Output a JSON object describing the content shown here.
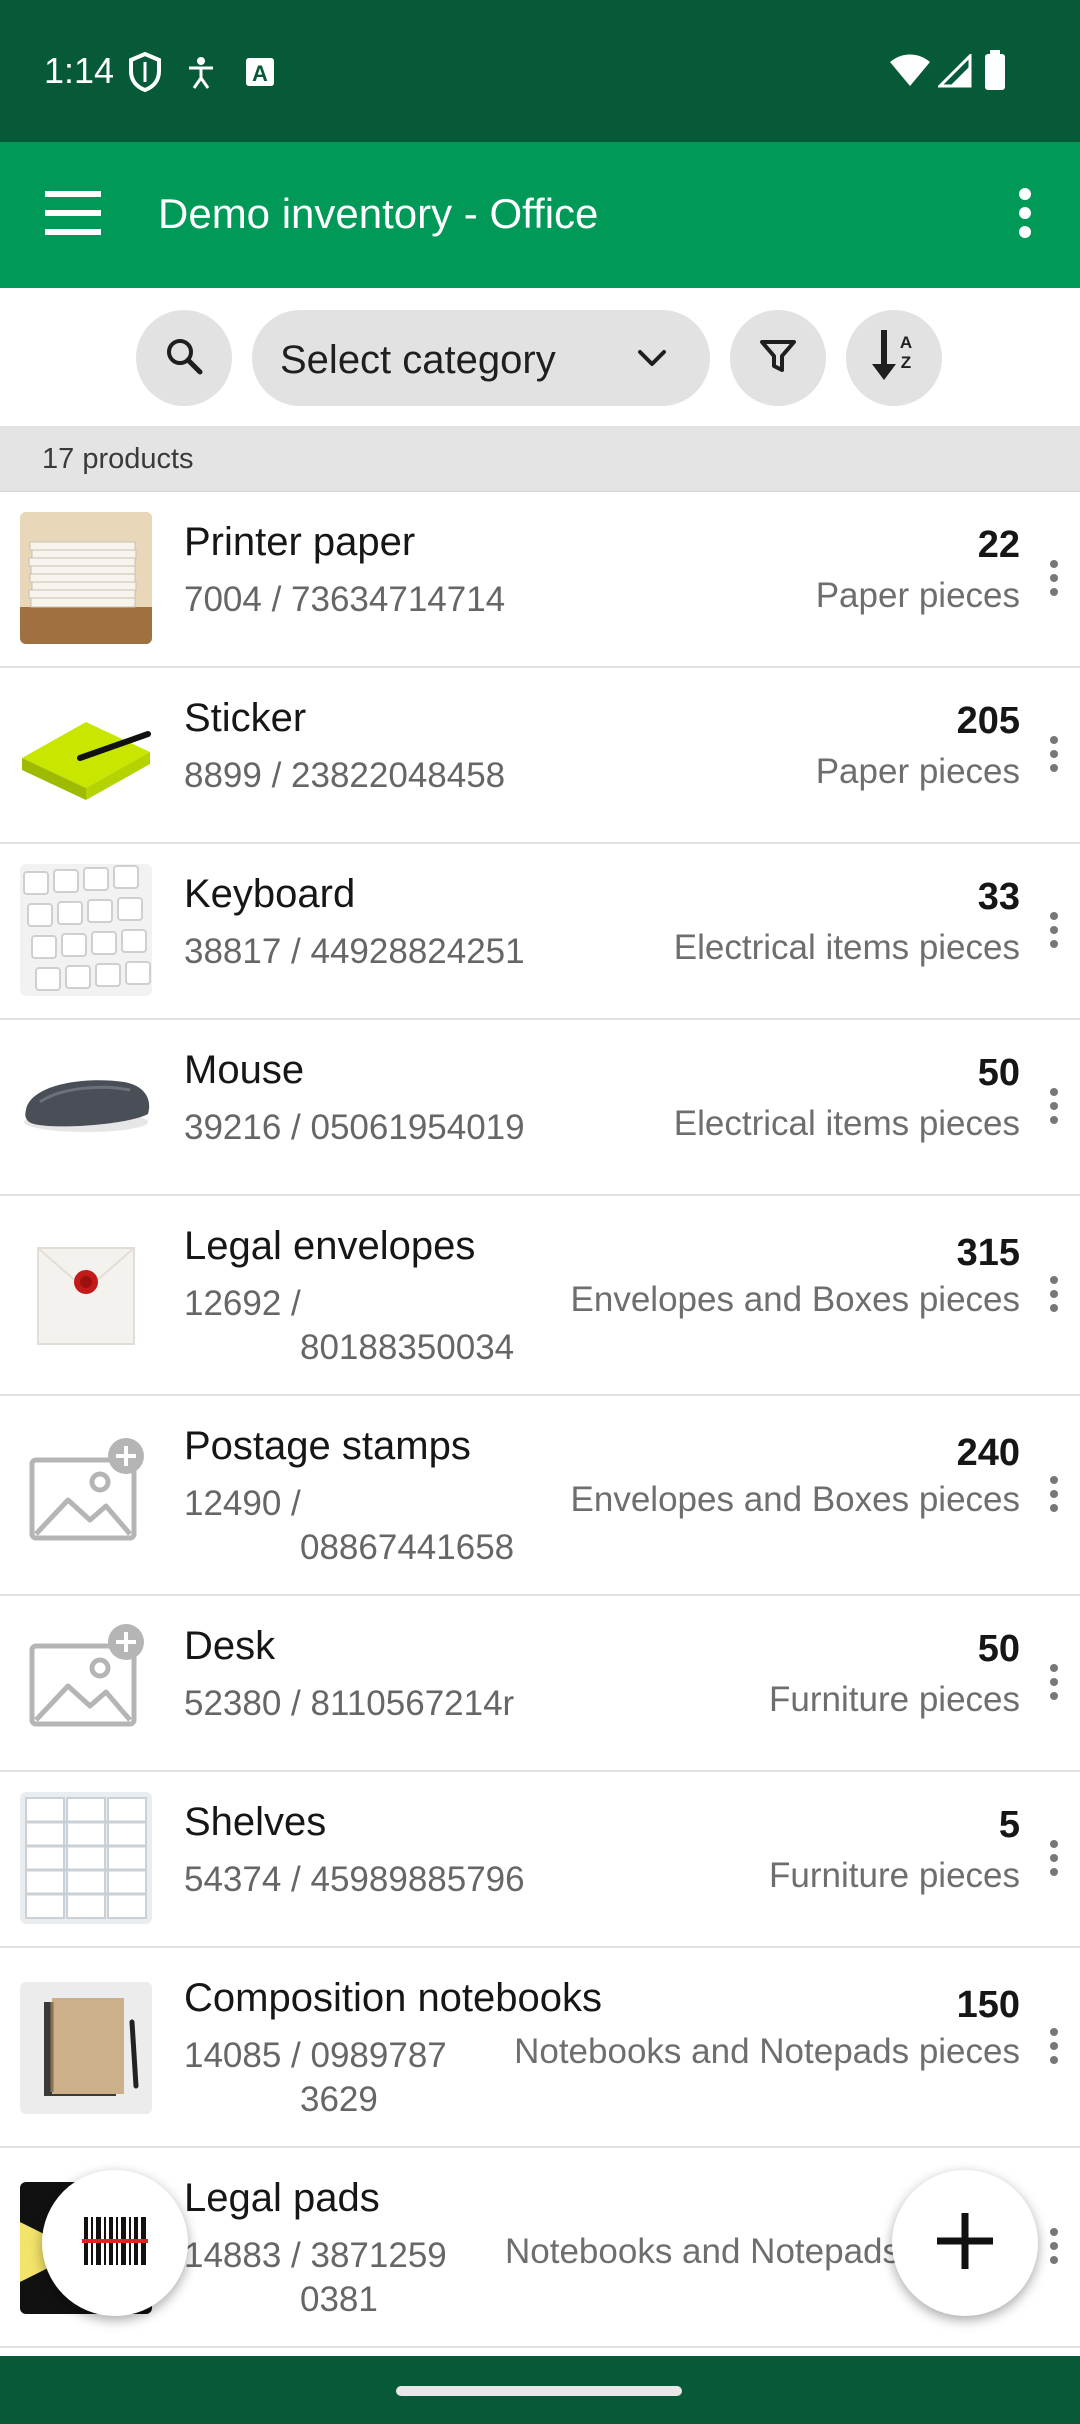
{
  "status_bar": {
    "time": "1:14",
    "icons": [
      "shield-icon",
      "accessibility-icon",
      "keyboard-a-icon",
      "wifi-icon",
      "signal-icon",
      "battery-icon"
    ]
  },
  "app_bar": {
    "title": "Demo inventory - Office",
    "icons": [
      "menu-icon",
      "more-vert-icon"
    ]
  },
  "toolbar": {
    "category_placeholder": "Select category",
    "icons": [
      "search-icon",
      "chevron-down-icon",
      "filter-icon",
      "sort-az-icon"
    ]
  },
  "list_header": {
    "count_label": "17 products"
  },
  "products": [
    {
      "name": "Printer paper",
      "code_line1": "7004 / 73634714714",
      "code_line2": "",
      "qty": "22",
      "unit": "Paper pieces",
      "thumb": "paper-stack"
    },
    {
      "name": "Sticker",
      "code_line1": "8899 / 23822048458",
      "code_line2": "",
      "qty": "205",
      "unit": "Paper pieces",
      "thumb": "sticky-note"
    },
    {
      "name": "Keyboard",
      "code_line1": "38817 / 44928824251",
      "code_line2": "",
      "qty": "33",
      "unit": "Electrical items pieces",
      "thumb": "keyboard"
    },
    {
      "name": "Mouse",
      "code_line1": "39216 / 05061954019",
      "code_line2": "",
      "qty": "50",
      "unit": "Electrical items pieces",
      "thumb": "mouse"
    },
    {
      "name": "Legal envelopes",
      "code_line1": "12692 /",
      "code_line2": "80188350034",
      "qty": "315",
      "unit": "Envelopes and Boxes pieces",
      "thumb": "envelope"
    },
    {
      "name": "Postage stamps",
      "code_line1": "12490 /",
      "code_line2": "08867441658",
      "qty": "240",
      "unit": "Envelopes and Boxes pieces",
      "thumb": "placeholder"
    },
    {
      "name": "Desk",
      "code_line1": "52380 / 8110567214r",
      "code_line2": "",
      "qty": "50",
      "unit": "Furniture pieces",
      "thumb": "placeholder"
    },
    {
      "name": "Shelves",
      "code_line1": "54374 / 45989885796",
      "code_line2": "",
      "qty": "5",
      "unit": "Furniture pieces",
      "thumb": "shelves"
    },
    {
      "name": "Composition notebooks",
      "code_line1": "14085 / 0989787",
      "code_line2": "3629",
      "qty": "150",
      "unit": "Notebooks and Notepads pieces",
      "thumb": "notebook"
    },
    {
      "name": "Legal pads",
      "code_line1": "14883 / 3871259",
      "code_line2": "0381",
      "qty": "",
      "unit": "Notebooks and Notepads",
      "thumb": "legal-pad"
    }
  ],
  "fabs": {
    "scan_icon": "barcode-scan-icon",
    "add_icon": "plus-icon"
  },
  "colors": {
    "status_bar": "#075a38",
    "app_bar": "#009957",
    "chip_bg": "#e2e2e2",
    "count_bar": "#e4e4e4"
  }
}
